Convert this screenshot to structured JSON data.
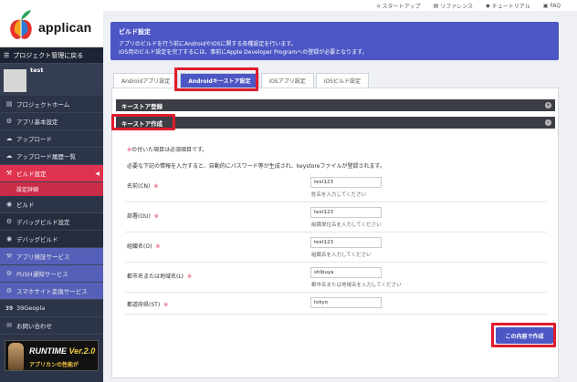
{
  "app": {
    "logo_text": "applican"
  },
  "topbar": {
    "items": [
      "スタートアップ",
      "リファレンス",
      "チュートリアル",
      "FAQ"
    ]
  },
  "sidebar": {
    "back_label": "プロジェクト管理に戻る",
    "user_name": "test",
    "items": [
      {
        "label": "プロジェクトホーム",
        "icon": "document-icon"
      },
      {
        "label": "アプリ基本設定",
        "icon": "gear-icon"
      },
      {
        "label": "アップロード",
        "icon": "cloud-upload-icon"
      },
      {
        "label": "アップロード履歴一覧",
        "icon": "cloud-list-icon"
      },
      {
        "label": "ビルド設定",
        "icon": "wrench-icon"
      },
      {
        "label": "ビルド",
        "icon": "build-icon"
      },
      {
        "label": "デバッグビルド設定",
        "icon": "gear-icon"
      },
      {
        "label": "デバッグビルド",
        "icon": "build-icon"
      },
      {
        "label": "アプリ検証サービス",
        "icon": "wrench-icon"
      },
      {
        "label": "PUSH通知サービス",
        "icon": "gear-icon"
      },
      {
        "label": "スマホサイト変換サービス",
        "icon": "gear-icon"
      },
      {
        "label": "39Geopla",
        "icon": "geopla-icon"
      },
      {
        "label": "お問い合わせ",
        "icon": "mail-icon"
      }
    ],
    "sub_item": "設定詳細",
    "banner": {
      "title_main": "RUNTIME",
      "title_ver": "Ver.2.0",
      "subtitle": "アプリカンの性能がUP！！"
    }
  },
  "header": {
    "title": "ビルド設定",
    "desc1": "アプリのビルドを行う前にAndroidやiOSに関する各種設定を行います。",
    "desc2": "iOS用のビルド設定を完了するには、事前にApple Developer Programへの登録が必要となります。"
  },
  "tabs": [
    "Androidアプリ設定",
    "Androidキーストア設定",
    "iOSアプリ設定",
    "iOSビルド設定"
  ],
  "sections": {
    "keystore_register": "キーストア登録",
    "keystore_create": "キーストア作成"
  },
  "form": {
    "required_mark": "※",
    "required_note": "の付いた項目は必須項目です。",
    "info_note": "必要な下記の情報を入力すると、自動的にパスワード等が生成され、keystoreファイルが登録されます。",
    "fields": [
      {
        "label": "名前(CN)",
        "value": "test123",
        "hint": "姓名を入力してください",
        "required": true
      },
      {
        "label": "部署(OU)",
        "value": "test123",
        "hint": "組織単位名を入力してください",
        "required": true
      },
      {
        "label": "組織名(O)",
        "value": "test123",
        "hint": "組織名を入力してください",
        "required": true
      },
      {
        "label": "都市名または地域名(L)",
        "value": "shibuya",
        "hint": "都市名または地域名を入力してください",
        "required": true
      },
      {
        "label": "都道府県(ST)",
        "value": "tokyo",
        "hint": "",
        "required": true
      }
    ],
    "submit_label": "この内容で作成"
  }
}
